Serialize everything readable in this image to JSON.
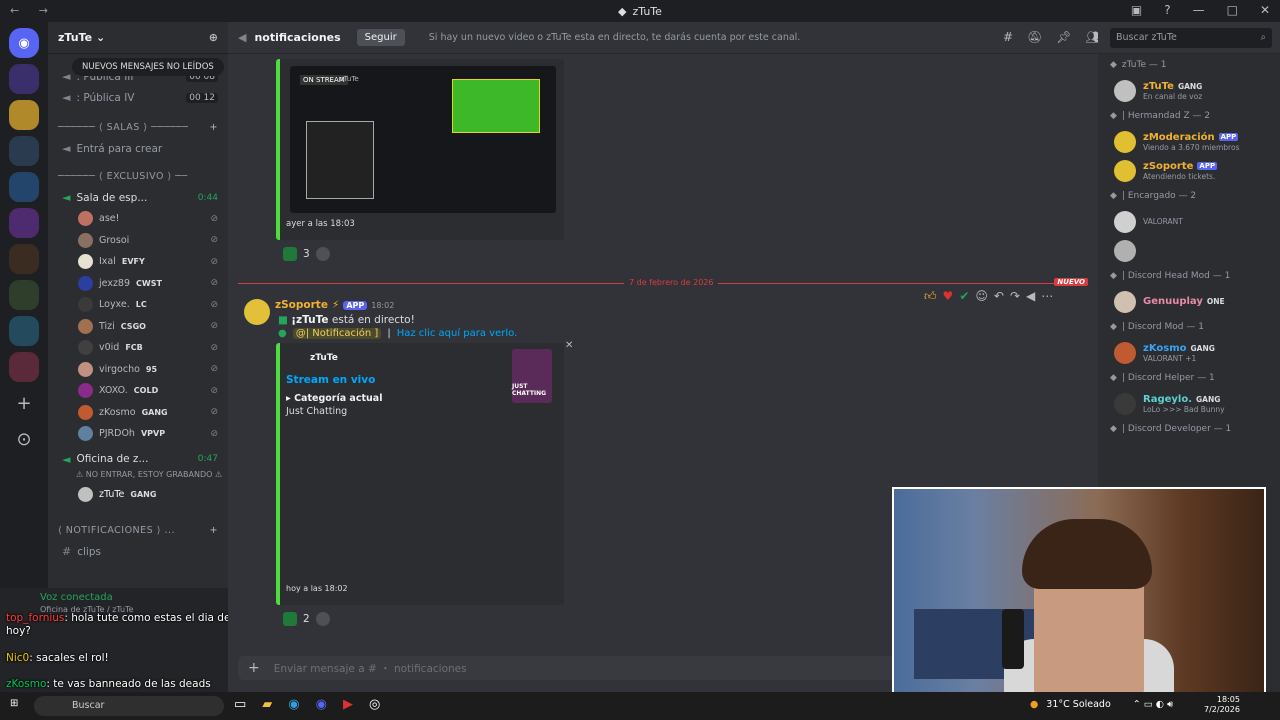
{
  "titlebar": {
    "title": "zTuTe"
  },
  "server_header": {
    "name": "zTuTe"
  },
  "unread_pill": "NUEVOS MENSAJES NO LEÍDOS",
  "channels": {
    "voice": [
      {
        "label": ": Pública III",
        "badge": "00 08"
      },
      {
        "label": ": Pública IV",
        "badge": "00 12"
      }
    ],
    "cat_salas": "──────  ⟨ SALAS ⟩  ──────",
    "create_label": "Entrá para crear",
    "cat_exclusivo": "──────  ⟨ EXCLUSIVO ⟩  ──",
    "sala_espera": "Sala de esp...",
    "sala_timer": "0:44",
    "voice_users": [
      {
        "name": "ase!",
        "tag": "",
        "color": "#c07060"
      },
      {
        "name": "Grosoi",
        "tag": "",
        "color": "#8a7060"
      },
      {
        "name": "Ixal",
        "tag": "EVFY",
        "color": "#e8e0d0"
      },
      {
        "name": "jexz89",
        "tag": "CWST",
        "color": "#2b3fa0"
      },
      {
        "name": "Loyxe.",
        "tag": "LC",
        "color": "#3a3a3a"
      },
      {
        "name": "Tizi",
        "tag": "CSGO",
        "color": "#a07050"
      },
      {
        "name": "v0id",
        "tag": "FCB",
        "color": "#404040"
      },
      {
        "name": "virgocho",
        "tag": "95",
        "color": "#c09080"
      },
      {
        "name": "XOXO.",
        "tag": "COLD",
        "color": "#8a2a8a"
      },
      {
        "name": "zKosmo",
        "tag": "GANG",
        "color": "#c05a30"
      },
      {
        "name": "PJRDOh",
        "tag": "VPVP",
        "color": "#6080a0"
      }
    ],
    "oficina": "Oficina de z...",
    "oficina_timer": "0:47",
    "oficina_note": "⚠ NO ENTRAR, ESTOY GRABANDO ⚠",
    "oficina_user": {
      "name": "zTuTe",
      "tag": "GANG"
    },
    "cat_notificaciones": "⟨ NOTIFICACIONES ⟩ ...",
    "clips": "clips"
  },
  "voice_status": {
    "title": "Voz conectada",
    "sub": "Oficina de zTuTe / zTuTe"
  },
  "chat_overlay": [
    {
      "user": "top_fornius",
      "text": ": hola tute como estas el dia de hoy?"
    },
    {
      "user": "Nic0",
      "text": ": sacales el rol!"
    },
    {
      "user": "zKosmo",
      "text": ": te vas banneado de las deads"
    }
  ],
  "topbar": {
    "channel": "notificaciones",
    "follow": "Seguir",
    "topic": "Si hay un nuevo video o zTuTe esta en directo, te darás cuenta por este canal.",
    "search_placeholder": "Buscar  zTuTe"
  },
  "message1": {
    "timestamp": "ayer a las 18:03",
    "reaction_count": "3",
    "thumb_stream": "ON STREAM",
    "thumb_name": "zTuTe"
  },
  "divider": {
    "date": "7 de febrero de 2026",
    "new": "NUEVO"
  },
  "message2": {
    "author": "zSoporte",
    "app": "APP",
    "time": "18:02",
    "line1_bold": "¡zTuTe",
    "line1_rest": " está en directo!",
    "mention": "@| Notificación ]",
    "link": "Haz clic aquí para verlo.",
    "embed_author": "zTuTe",
    "embed_title": "Stream en vivo",
    "field_name": "Categoría actual",
    "field_value": "Just Chatting",
    "thumb_text": "JUST CHATTING",
    "footer": "hoy a las 18:02",
    "reaction_count": "2"
  },
  "composer": {
    "placeholder": "Enviar mensaje a #  ・ notificaciones"
  },
  "members": {
    "groups": [
      {
        "title": "zTuTe — 1",
        "items": [
          {
            "name": "zTuTe",
            "tag": "GANG",
            "sub": "En canal de voz",
            "color": "#f0b232",
            "av": "#c0c0c0"
          }
        ]
      },
      {
        "title": "| Hermandad Z — 2",
        "items": [
          {
            "name": "zModeración",
            "tag": "APP",
            "sub": "Viendo a 3.670 miembros",
            "color": "#f0b232",
            "av": "#e0c030"
          },
          {
            "name": "zSoporte",
            "tag": "APP",
            "sub": "Atendiendo tickets.",
            "color": "#f0b232",
            "av": "#e0c030"
          }
        ]
      },
      {
        "title": "| Encargado — 2",
        "items": [
          {
            "name": "",
            "tag": "",
            "sub": "VALORANT",
            "color": "#e03030",
            "av": "#d0d0d0"
          },
          {
            "name": "",
            "tag": "",
            "sub": "",
            "color": "#e03030",
            "av": "#b0b0b0"
          }
        ]
      },
      {
        "title": "| Discord Head Mod — 1",
        "items": [
          {
            "name": "Genuuplay",
            "tag": "ONE",
            "sub": "",
            "color": "#e88aa8",
            "av": "#d0c0b0"
          }
        ]
      },
      {
        "title": "| Discord Mod — 1",
        "items": [
          {
            "name": "zKosmo",
            "tag": "GANG",
            "sub": "VALORANT +1",
            "color": "#3ba3f5",
            "av": "#c05a30"
          }
        ]
      },
      {
        "title": "| Discord Helper — 1",
        "items": [
          {
            "name": "Rageylo.",
            "tag": "GANG",
            "sub": "LoLo >>> Bad Bunny",
            "color": "#5dd0d0",
            "av": "#3a3a3a"
          }
        ]
      },
      {
        "title": "| Discord Developer — 1",
        "items": []
      }
    ]
  },
  "taskbar": {
    "search": "Buscar",
    "weather": "31°C  Soleado",
    "time": "18:05",
    "date": "7/2/2026"
  }
}
